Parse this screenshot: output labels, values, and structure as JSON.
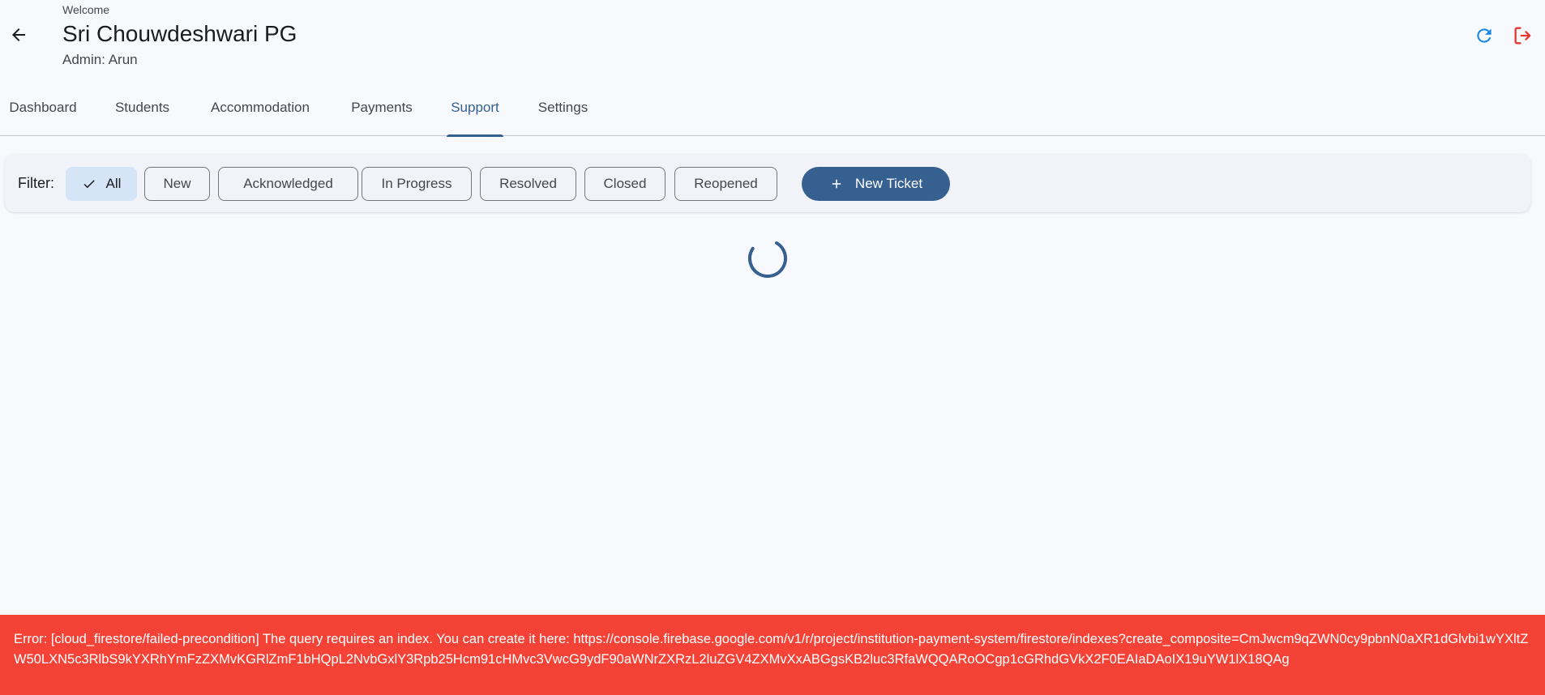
{
  "header": {
    "welcome": "Welcome",
    "title": "Sri Chouwdeshwari PG",
    "subtitle": "Admin: Arun",
    "icons": {
      "back": "arrow-back-icon",
      "refresh": "refresh-icon",
      "logout": "logout-icon"
    }
  },
  "tabs": [
    {
      "label": "Dashboard",
      "active": false
    },
    {
      "label": "Students",
      "active": false
    },
    {
      "label": "Accommodation",
      "active": false
    },
    {
      "label": "Payments",
      "active": false
    },
    {
      "label": "Support",
      "active": true
    },
    {
      "label": "Settings",
      "active": false
    }
  ],
  "filter": {
    "label": "Filter:",
    "chips": [
      {
        "label": "All",
        "selected": true
      },
      {
        "label": "New",
        "selected": false
      },
      {
        "label": "Acknowledged",
        "selected": false
      },
      {
        "label": "In Progress",
        "selected": false
      },
      {
        "label": "Resolved",
        "selected": false
      },
      {
        "label": "Closed",
        "selected": false
      },
      {
        "label": "Reopened",
        "selected": false
      }
    ],
    "new_ticket_label": "New Ticket"
  },
  "error": {
    "message": "Error: [cloud_firestore/failed-precondition] The query requires an index. You can create it here: https://console.firebase.google.com/v1/r/project/institution-payment-system/firestore/indexes?create_composite=CmJwcm9qZWN0cy9pbnN0aXR1dGlvbi1wYXltZW50LXN5c3RlbS9kYXRhYmFzZXMvKGRlZmF1bHQpL2NvbGxlY3Rpb25Hcm91cHMvc3VwcG9ydF90aWNrZXRzL2luZGV4ZXMvXxABGgsKB2luc3RfaWQQARoOCgp1cGRhdGVkX2F0EAIaDAoIX19uYW1lX18QAg"
  },
  "colors": {
    "primary": "#36608f",
    "accent_refresh": "#1e88e5",
    "logout": "#e53935",
    "error_bg": "#f44336",
    "chip_selected": "#d6e4f7"
  }
}
